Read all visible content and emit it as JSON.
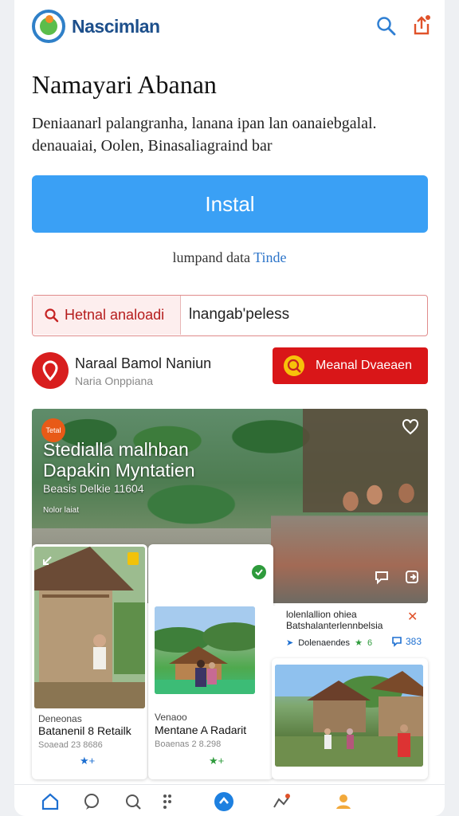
{
  "header": {
    "app_name": "Nascimlan",
    "icons": [
      "search-icon",
      "share-icon"
    ]
  },
  "listing": {
    "title": "Namayari Abanan",
    "description": "Deniaanarl palangranha, lanana ipan lan oanaiebgalal. denauaiai, Oolen, Binasaliagraind bar",
    "install_label": "Instal",
    "subnote_text": "lumpand data",
    "subnote_link": "Tinde"
  },
  "search": {
    "category_label": "Hetnal analoadi",
    "value": "lnangab'peless"
  },
  "developer": {
    "name": "Naraal Bamol Naniun",
    "subtitle": "Naria Onppiana",
    "follow_label": "Meanal Dvaeaen"
  },
  "hero": {
    "badge": "Tetal",
    "title_line1": "Stedialla malhban",
    "title_line2": "Dapakin Myntatien",
    "subtitle": "Beasis Delkie 11604",
    "tag": "Nolor laiat"
  },
  "cards": [
    {
      "caption_top": "Deneonas",
      "title": "Batanenil 8 Retailk",
      "meta": "Soaead 23 8686",
      "stars": "★+"
    },
    {
      "caption_top": "Venaoo",
      "title": "Mentane A Radarit",
      "meta": "Boaenas 2 8.298",
      "stars": "★+"
    },
    {
      "title": "lolenlallion ohiea",
      "subtitle": "Batshalanterlennbelsia",
      "meta_left": "Dolenaendes",
      "rating": "6",
      "comments": "383"
    }
  ],
  "colors": {
    "install_blue": "#3aa0f5",
    "follow_red": "#d91618",
    "brand_blue": "#1d4f8b"
  },
  "bottom_nav": [
    "home-icon",
    "chat-icon",
    "discover-icon",
    "apps-icon",
    "updates-icon",
    "library-icon",
    "profile-icon"
  ]
}
